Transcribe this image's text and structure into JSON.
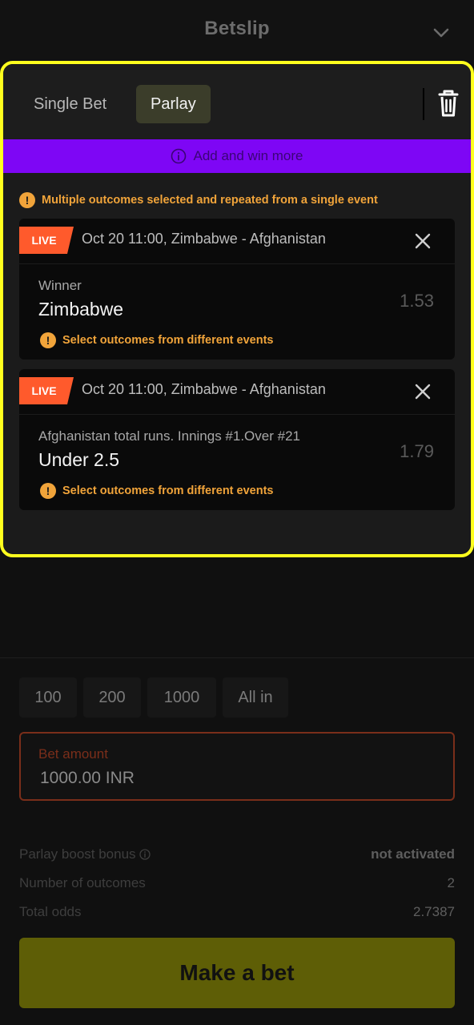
{
  "header": {
    "title": "Betslip"
  },
  "tabs": {
    "single": "Single Bet",
    "parlay": "Parlay"
  },
  "promo": {
    "text": "Add and win more"
  },
  "warning_main": "Multiple outcomes selected and repeated from a single event",
  "bets": [
    {
      "live": "LIVE",
      "event": "Oct 20 11:00, Zimbabwe - Afghanistan",
      "market": "Winner",
      "selection": "Zimbabwe",
      "odds": "1.53",
      "warning": "Select outcomes from different events"
    },
    {
      "live": "LIVE",
      "event": "Oct 20 11:00, Zimbabwe - Afghanistan",
      "market": "Afghanistan total runs. Innings #1.Over #21",
      "selection": "Under 2.5",
      "odds": "1.79",
      "warning": "Select outcomes from different events"
    }
  ],
  "quick_amounts": [
    "100",
    "200",
    "1000",
    "All in"
  ],
  "bet_amount": {
    "label": "Bet amount",
    "value": "1000.00 INR"
  },
  "summary": {
    "boost_label": "Parlay boost bonus",
    "boost_value": "not activated",
    "outcomes_label": "Number of outcomes",
    "outcomes_value": "2",
    "odds_label": "Total odds",
    "odds_value": "2.7387"
  },
  "make_bet": "Make a bet",
  "colors": {
    "highlight": "#ffff1e",
    "promo": "#7e06f5",
    "live": "#ff5a2c",
    "warning": "#f1a43a",
    "cta": "#5e5e06"
  },
  "icons": {
    "chevron": "chevron-down-icon",
    "trash": "trash-icon",
    "info": "info-icon",
    "close": "close-icon",
    "warning": "warning-icon"
  }
}
